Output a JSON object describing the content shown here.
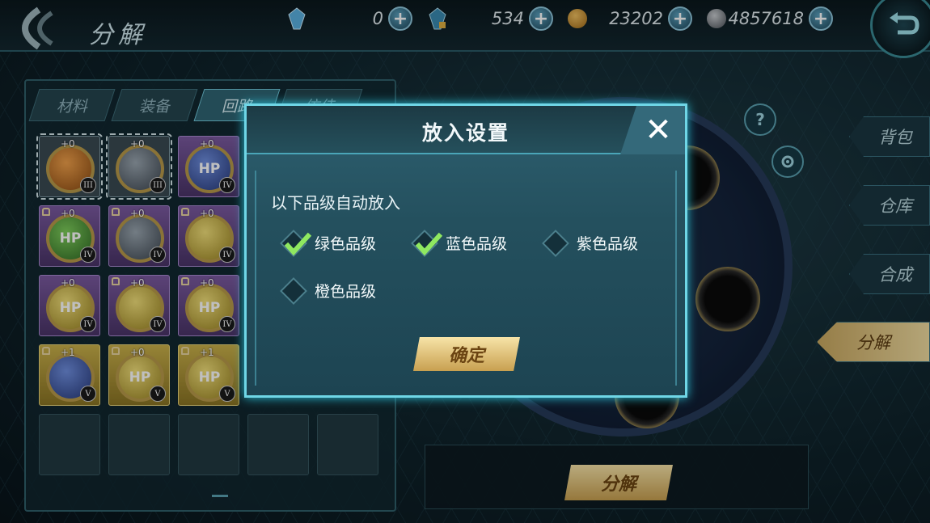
{
  "header": {
    "title": "分解",
    "resources": [
      {
        "icon": "blue-crystal-icon",
        "value": "0"
      },
      {
        "icon": "locked-crystal-icon",
        "value": "534"
      },
      {
        "icon": "gold-coin-icon",
        "value": "23202"
      },
      {
        "icon": "silver-coin-icon",
        "value": "4857618"
      }
    ],
    "plus_label": "+"
  },
  "inventory": {
    "tabs": [
      {
        "label": "材料",
        "active": false
      },
      {
        "label": "装备",
        "active": false
      },
      {
        "label": "回路",
        "active": true
      },
      {
        "label": "仿佳",
        "active": false
      }
    ]
  },
  "slots": [
    {
      "quality": "gray",
      "orb": "orange",
      "text": "",
      "level": "+0",
      "grade": "III",
      "locked": false,
      "selected": true
    },
    {
      "quality": "gray",
      "orb": "steel",
      "text": "",
      "level": "+0",
      "grade": "III",
      "locked": false,
      "selected": true
    },
    {
      "quality": "purple",
      "orb": "blue",
      "text": "HP",
      "level": "+0",
      "grade": "IV",
      "locked": false,
      "selected": false
    },
    {
      "quality": "purple",
      "orb": "green",
      "text": "HP",
      "level": "+0",
      "grade": "IV",
      "locked": true,
      "selected": false
    },
    {
      "quality": "purple",
      "orb": "steel",
      "text": "",
      "level": "+0",
      "grade": "IV",
      "locked": true,
      "selected": false
    },
    {
      "quality": "purple",
      "orb": "yellow",
      "text": "",
      "level": "+0",
      "grade": "IV",
      "locked": true,
      "selected": false
    },
    {
      "quality": "purple",
      "orb": "yellow",
      "text": "HP",
      "level": "+0",
      "grade": "IV",
      "locked": false,
      "selected": false
    },
    {
      "quality": "purple",
      "orb": "yellow",
      "text": "",
      "level": "+0",
      "grade": "IV",
      "locked": true,
      "selected": false
    },
    {
      "quality": "purple",
      "orb": "yellow",
      "text": "HP",
      "level": "+0",
      "grade": "IV",
      "locked": true,
      "selected": false
    },
    {
      "quality": "gold",
      "orb": "blue",
      "text": "",
      "level": "+1",
      "grade": "V",
      "locked": true,
      "selected": false
    },
    {
      "quality": "gold",
      "orb": "yellow",
      "text": "HP",
      "level": "+0",
      "grade": "V",
      "locked": true,
      "selected": false
    },
    {
      "quality": "gold",
      "orb": "yellow",
      "text": "HP",
      "level": "+1",
      "grade": "V",
      "locked": true,
      "selected": false
    }
  ],
  "side_menu": [
    "背包",
    "仓库",
    "合成",
    "分解"
  ],
  "side_menu_active": "分解",
  "decompose_button": "分解",
  "dialog": {
    "title": "放入设置",
    "close_icon": "close-icon",
    "subtitle": "以下品级自动放入",
    "options": [
      {
        "label": "绿色品级",
        "checked": true
      },
      {
        "label": "蓝色品级",
        "checked": true
      },
      {
        "label": "紫色品级",
        "checked": false
      },
      {
        "label": "橙色品级",
        "checked": false
      }
    ],
    "confirm": "确定"
  },
  "colors": {
    "accent_cyan": "#6fd6e6",
    "check_green": "#8fe860",
    "gold_button": "#f0dca0"
  }
}
